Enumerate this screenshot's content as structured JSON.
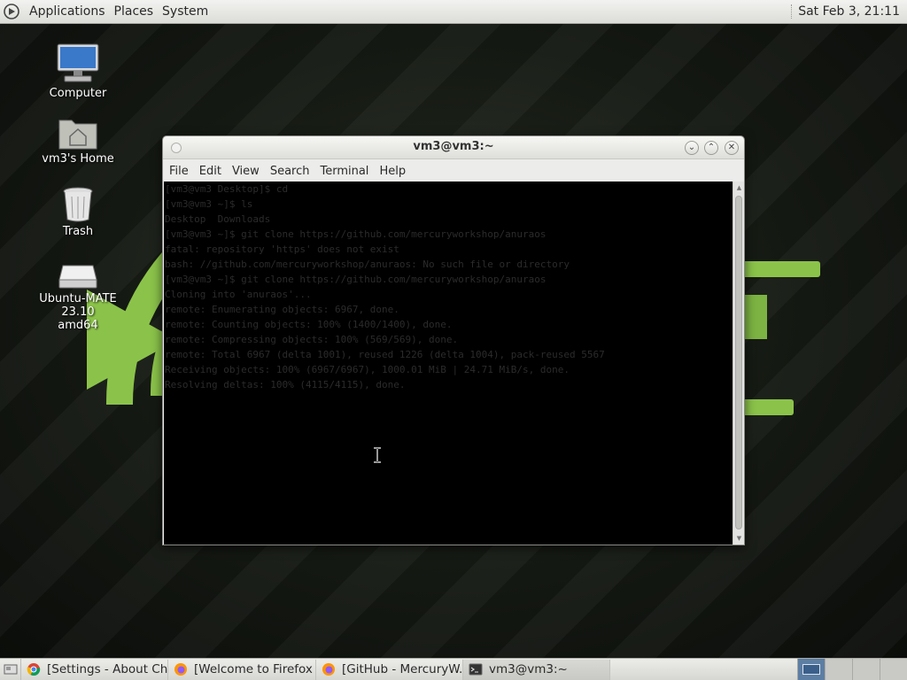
{
  "top_panel": {
    "menus": [
      "Applications",
      "Places",
      "System"
    ],
    "clock": "Sat Feb  3, 21:11"
  },
  "desktop": {
    "icons": [
      {
        "label": "Computer",
        "icon": "computer-icon"
      },
      {
        "label": "vm3's Home",
        "icon": "home-folder-icon"
      },
      {
        "label": "Trash",
        "icon": "trash-icon"
      },
      {
        "label_line1": "Ubuntu-MATE 23.10",
        "label_line2": "amd64",
        "icon": "drive-icon"
      }
    ]
  },
  "terminal_window": {
    "title": "vm3@vm3:~",
    "menus": [
      "File",
      "Edit",
      "View",
      "Search",
      "Terminal",
      "Help"
    ],
    "lines": [
      "[vm3@vm3 Desktop]$ cd",
      "[vm3@vm3 ~]$ ls",
      "Desktop  Downloads",
      "[vm3@vm3 ~]$ git clone https://github.com/mercuryworkshop/anuraos",
      "fatal: repository 'https' does not exist",
      "bash: //github.com/mercuryworkshop/anuraos: No such file or directory",
      "[vm3@vm3 ~]$ git clone https://github.com/mercuryworkshop/anuraos",
      "Cloning into 'anuraos'...",
      "remote: Enumerating objects: 6967, done.",
      "remote: Counting objects: 100% (1400/1400), done.",
      "remote: Compressing objects: 100% (569/569), done.",
      "remote: Total 6967 (delta 1001), reused 1226 (delta 1004), pack-reused 5567",
      "Receiving objects: 100% (6967/6967), 1000.01 MiB | 24.71 MiB/s, done.",
      "Resolving deltas: 100% (4115/4115), done."
    ]
  },
  "taskbar": {
    "tasks": [
      {
        "label": "[Settings - About Ch...",
        "icon": "chrome-icon"
      },
      {
        "label": "[Welcome to Firefox ...",
        "icon": "firefox-icon"
      },
      {
        "label": "[GitHub - MercuryW...",
        "icon": "firefox-icon"
      },
      {
        "label": "vm3@vm3:~",
        "icon": "terminal-icon"
      }
    ],
    "workspaces": 4,
    "active_workspace": 1
  },
  "colors": {
    "wallpaper_accent": "#8bc34a",
    "terminal_bg": "#000000",
    "active_workspace": "#5d7ea3"
  }
}
